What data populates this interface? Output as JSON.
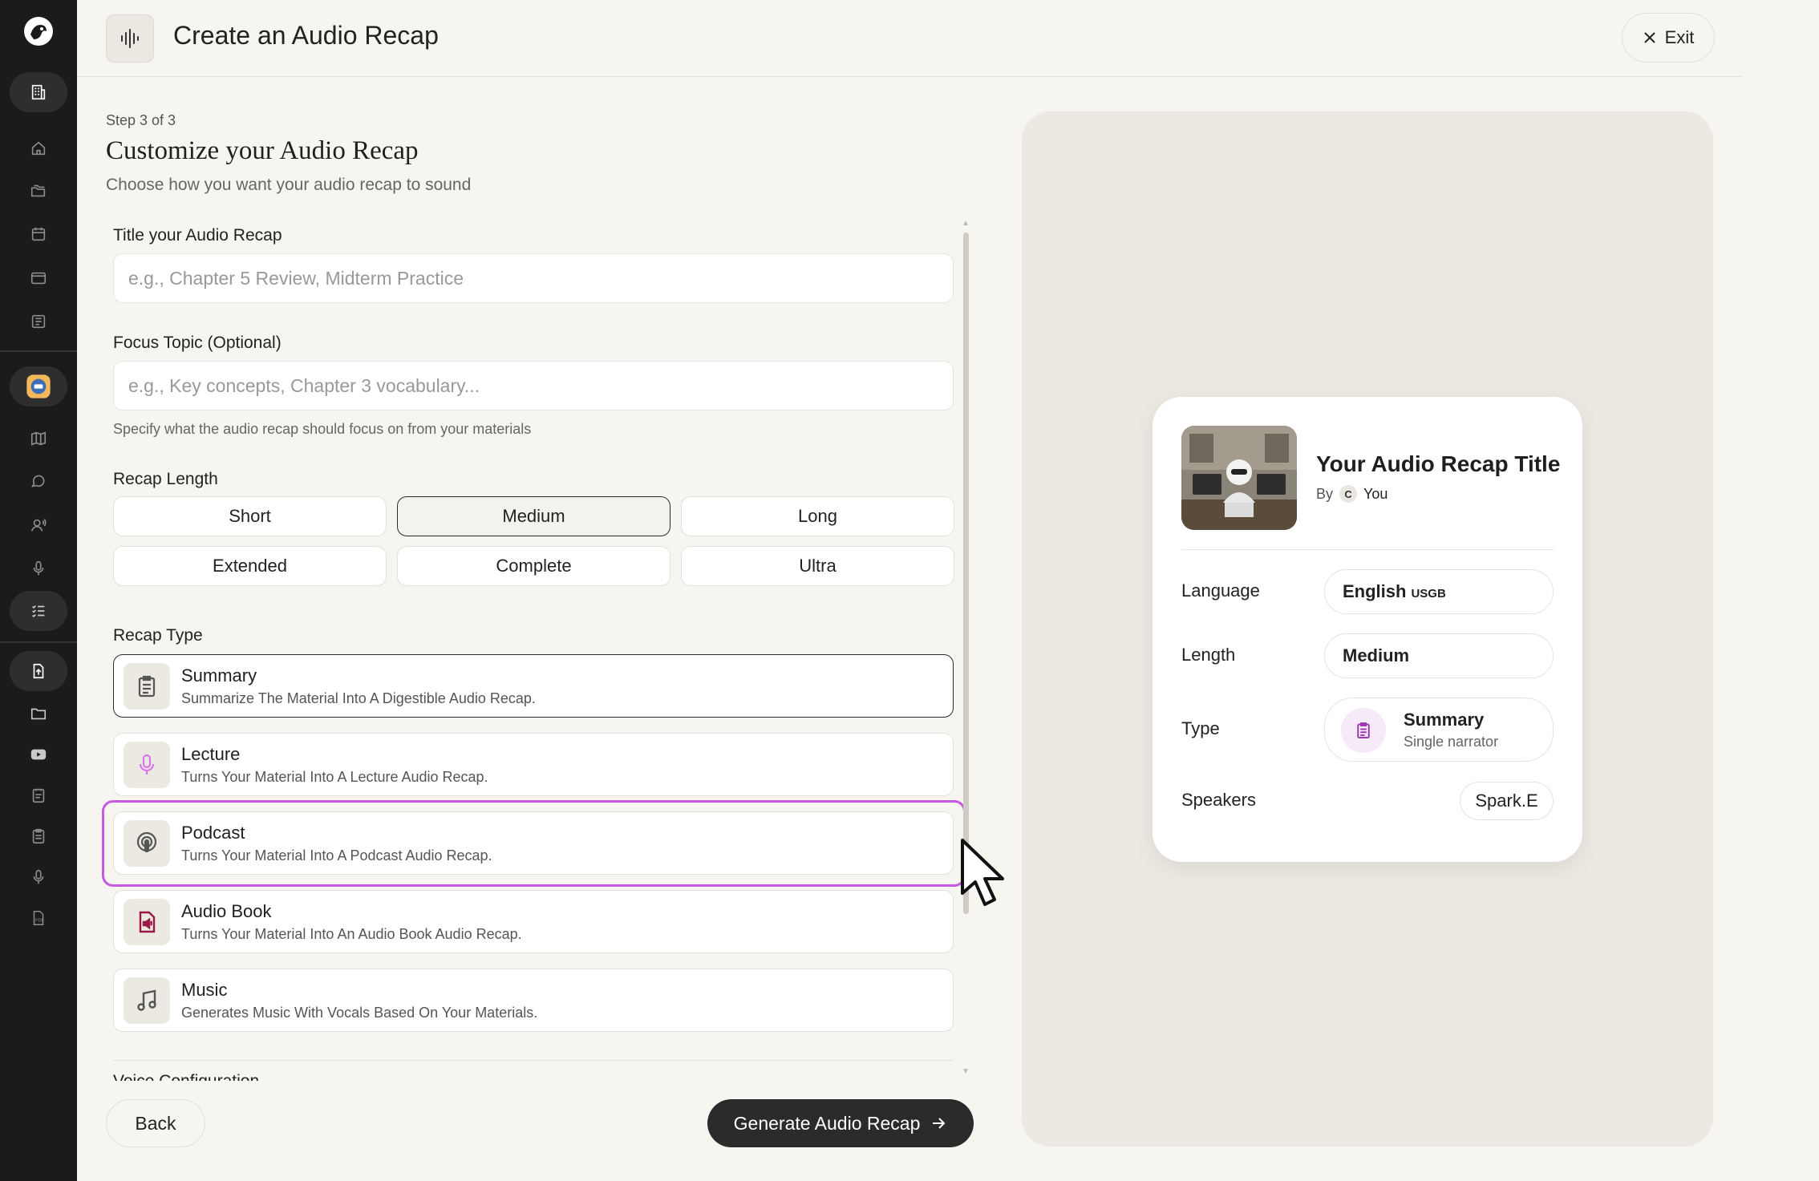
{
  "header": {
    "title": "Create an Audio Recap",
    "exit_label": "Exit"
  },
  "sidebar": {
    "items": [
      {
        "icon": "logo-icon"
      },
      {
        "icon": "building-icon"
      },
      {
        "icon": "home-icon"
      },
      {
        "icon": "folders-icon"
      },
      {
        "icon": "calendar-icon"
      },
      {
        "icon": "browser-icon"
      },
      {
        "icon": "library-icon"
      },
      {
        "icon": "course-app-icon"
      },
      {
        "icon": "map-icon"
      },
      {
        "icon": "chat-icon"
      },
      {
        "icon": "voice-chat-icon"
      },
      {
        "icon": "microphone-icon"
      },
      {
        "icon": "checklist-icon"
      },
      {
        "icon": "file-upload-icon"
      },
      {
        "icon": "folder-icon"
      },
      {
        "icon": "youtube-icon"
      },
      {
        "icon": "document-icon"
      },
      {
        "icon": "clipboard-icon"
      },
      {
        "icon": "microphone-icon"
      },
      {
        "icon": "pdf-icon"
      }
    ]
  },
  "form": {
    "step": "Step 3 of 3",
    "title": "Customize your Audio Recap",
    "subtitle": "Choose how you want your audio recap to sound",
    "title_field": {
      "label": "Title your Audio Recap",
      "value": "",
      "placeholder": "e.g., Chapter 5 Review, Midterm Practice"
    },
    "focus_field": {
      "label": "Focus Topic (Optional)",
      "value": "",
      "placeholder": "e.g., Key concepts, Chapter 3 vocabulary...",
      "hint": "Specify what the audio recap should focus on from your materials"
    },
    "length": {
      "label": "Recap Length",
      "options": [
        "Short",
        "Medium",
        "Long",
        "Extended",
        "Complete",
        "Ultra"
      ],
      "selected": "Medium"
    },
    "type": {
      "label": "Recap Type",
      "selected": "Summary",
      "options": [
        {
          "name": "Summary",
          "desc": "Summarize The Material Into A Digestible Audio Recap.",
          "icon": "clipboard-icon"
        },
        {
          "name": "Lecture",
          "desc": "Turns Your Material Into A Lecture Audio Recap.",
          "icon": "microphone-icon"
        },
        {
          "name": "Podcast",
          "desc": "Turns Your Material Into A Podcast Audio Recap.",
          "icon": "podcast-icon"
        },
        {
          "name": "Audio Book",
          "desc": "Turns Your Material Into An Audio Book Audio Recap.",
          "icon": "audio-file-icon"
        },
        {
          "name": "Music",
          "desc": "Generates Music With Vocals Based On Your Materials.",
          "icon": "music-note-icon"
        }
      ]
    },
    "next_section_label": "Voice Configuration",
    "back_label": "Back",
    "generate_label": "Generate Audio Recap"
  },
  "preview": {
    "title": "Your Audio Recap Title",
    "by_label": "By",
    "author_initial": "C",
    "author_name": "You",
    "language_label": "Language",
    "language_value": "English",
    "language_sub": "USGB",
    "length_label": "Length",
    "length_value": "Medium",
    "type_label": "Type",
    "type_value": "Summary",
    "type_sub": "Single narrator",
    "speakers_label": "Speakers",
    "speaker_value": "Spark.E"
  },
  "colors": {
    "sidebar_bg": "#1b1b1b",
    "page_bg": "#f7f5f0",
    "accent_hover": "#c659e0",
    "primary_button": "#2b2b2b",
    "lecture_icon": "#d777e6",
    "audiobook_icon": "#9a1a47",
    "summary_type_icon": "#9b3bb0"
  }
}
